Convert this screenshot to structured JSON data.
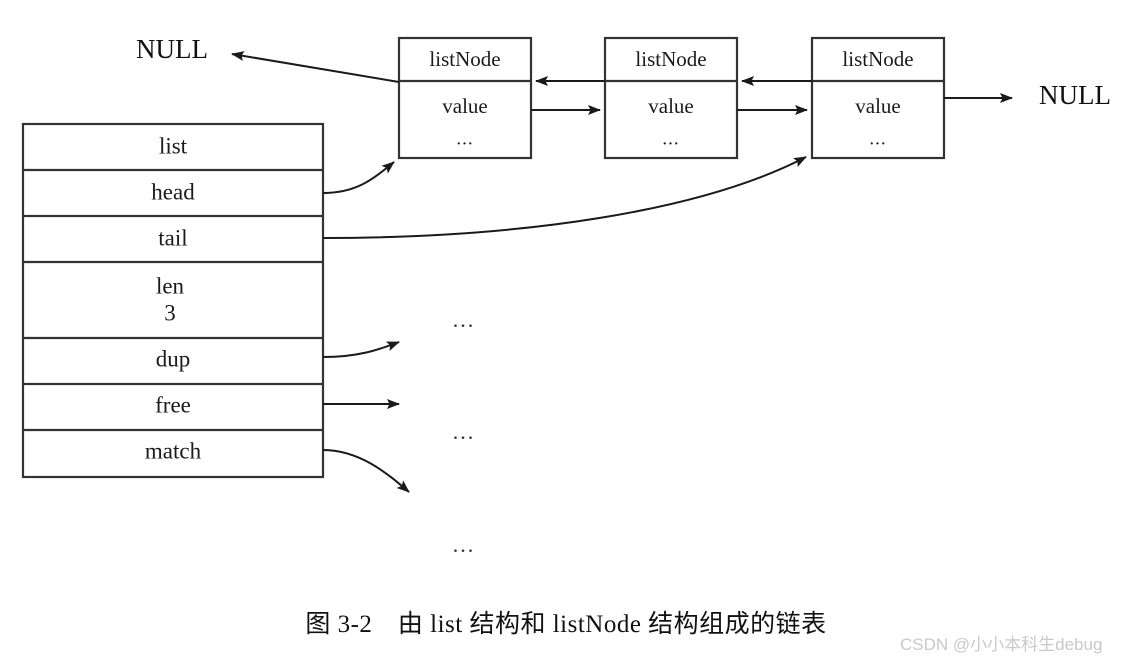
{
  "figure": {
    "caption": "图 3-2　由 list 结构和 listNode 结构组成的链表",
    "watermark": "CSDN @小小本科生debug"
  },
  "list_struct": {
    "title": "list",
    "fields": [
      {
        "name": "list",
        "label": "list",
        "value": ""
      },
      {
        "name": "head",
        "label": "head",
        "value": ""
      },
      {
        "name": "tail",
        "label": "tail",
        "value": ""
      },
      {
        "name": "len",
        "label": "len",
        "value": "3"
      },
      {
        "name": "dup",
        "label": "dup",
        "value": ""
      },
      {
        "name": "free",
        "label": "free",
        "value": ""
      },
      {
        "name": "match",
        "label": "match",
        "value": ""
      }
    ]
  },
  "nodes": [
    {
      "type": "listNode",
      "value_label": "value",
      "more": "..."
    },
    {
      "type": "listNode",
      "value_label": "value",
      "more": "..."
    },
    {
      "type": "listNode",
      "value_label": "value",
      "more": "..."
    }
  ],
  "terminators": {
    "prev_null": "NULL",
    "next_null": "NULL"
  },
  "callback_targets": [
    {
      "for": "dup",
      "mark": "..."
    },
    {
      "for": "free",
      "mark": "..."
    },
    {
      "for": "match",
      "mark": "..."
    }
  ],
  "colors": {
    "stroke": "#333333",
    "arrow": "#1a1a1a",
    "text": "#111111",
    "background": "#ffffff",
    "watermark": "#c9c9c9"
  }
}
